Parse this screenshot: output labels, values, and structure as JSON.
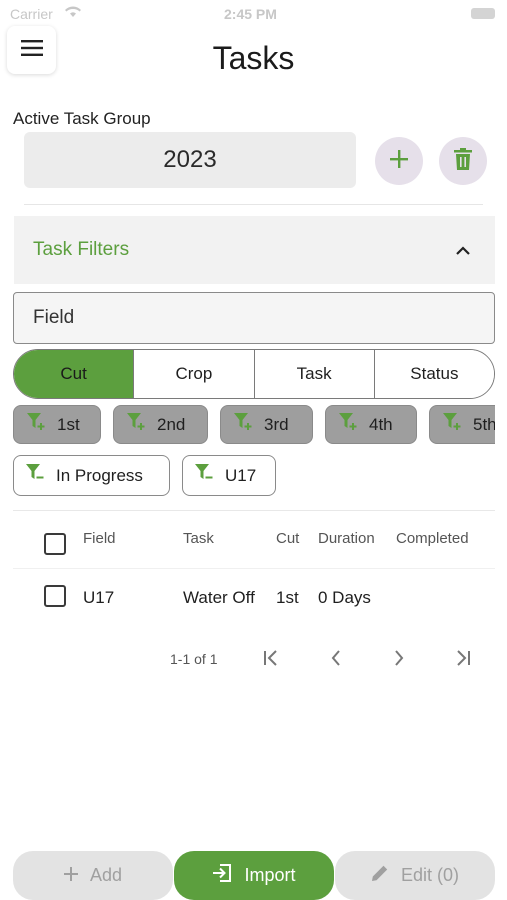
{
  "status_bar": {
    "carrier": "Carrier",
    "time": "2:45 PM"
  },
  "header": {
    "title": "Tasks"
  },
  "task_group": {
    "label": "Active Task Group",
    "selected": "2023"
  },
  "filters": {
    "title": "Task Filters",
    "field_placeholder": "Field",
    "segments": [
      "Cut",
      "Crop",
      "Task",
      "Status"
    ],
    "active_segment": "Cut",
    "cut_chips": [
      "1st",
      "2nd",
      "3rd",
      "4th",
      "5th"
    ],
    "selected_chips": [
      "In Progress",
      "U17"
    ]
  },
  "table": {
    "columns": [
      "Field",
      "Task",
      "Cut",
      "Duration",
      "Completed"
    ],
    "rows": [
      {
        "field": "U17",
        "task": "Water Off",
        "cut": "1st",
        "duration": "0 Days",
        "completed": ""
      }
    ]
  },
  "pagination": {
    "range": "1-1 of 1"
  },
  "actions": {
    "add": "Add",
    "import": "Import",
    "edit": "Edit (0)"
  },
  "colors": {
    "accent": "#5c9f3e",
    "chip_inactive": "#9e9e9e",
    "round_button": "#e6e0ea"
  }
}
